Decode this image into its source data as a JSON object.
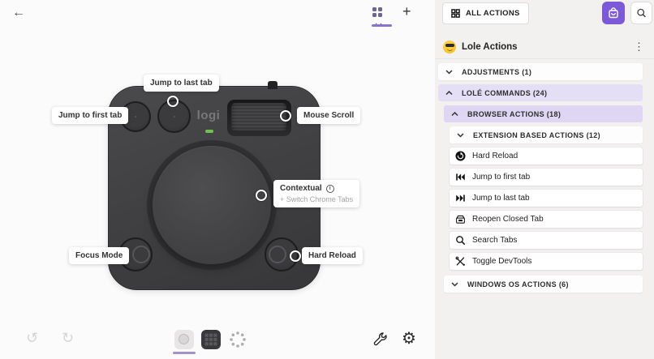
{
  "colors": {
    "accent_purple": "#7c59d9",
    "tab_underline": "#8a72d4",
    "lavender_row": "#e5dff6",
    "lavender_row_deep": "#ded6f2",
    "led_green": "#70c24d"
  },
  "glyphs": {
    "back": "←",
    "plus": "+",
    "kebab": "⋮",
    "gear": "⚙",
    "undo": "↺",
    "redo": "↻",
    "info": "i"
  },
  "device": {
    "logo": "logi",
    "callouts": {
      "jump_last": {
        "label": "Jump to last tab"
      },
      "jump_first": {
        "label": "Jump to first tab"
      },
      "mouse_scroll": {
        "label": "Mouse Scroll"
      },
      "contextual": {
        "label": "Contextual",
        "sublabel": "+ Switch Chrome Tabs"
      },
      "focus_mode": {
        "label": "Focus Mode"
      },
      "hard_reload": {
        "label": "Hard Reload"
      }
    }
  },
  "panel": {
    "all_actions_button": "ALL ACTIONS",
    "profile_title": "Lole Actions",
    "sections": {
      "adjustments": "ADJUSTMENTS (1)",
      "lole_commands": "LOLÉ COMMANDS (24)",
      "browser_actions": "BROWSER ACTIONS (18)",
      "extension_based": "EXTENSION BASED ACTIONS (12)",
      "windows_os": "WINDOWS OS ACTIONS (6)"
    },
    "actions": [
      {
        "icon": "hard-reload-icon",
        "label": "Hard Reload"
      },
      {
        "icon": "jump-first-icon",
        "label": "Jump to first tab"
      },
      {
        "icon": "jump-last-icon",
        "label": "Jump to last tab"
      },
      {
        "icon": "reopen-closed-tab-icon",
        "label": "Reopen Closed Tab"
      },
      {
        "icon": "search-icon",
        "label": "Search Tabs"
      },
      {
        "icon": "devtools-icon",
        "label": "Toggle DevTools"
      }
    ]
  }
}
